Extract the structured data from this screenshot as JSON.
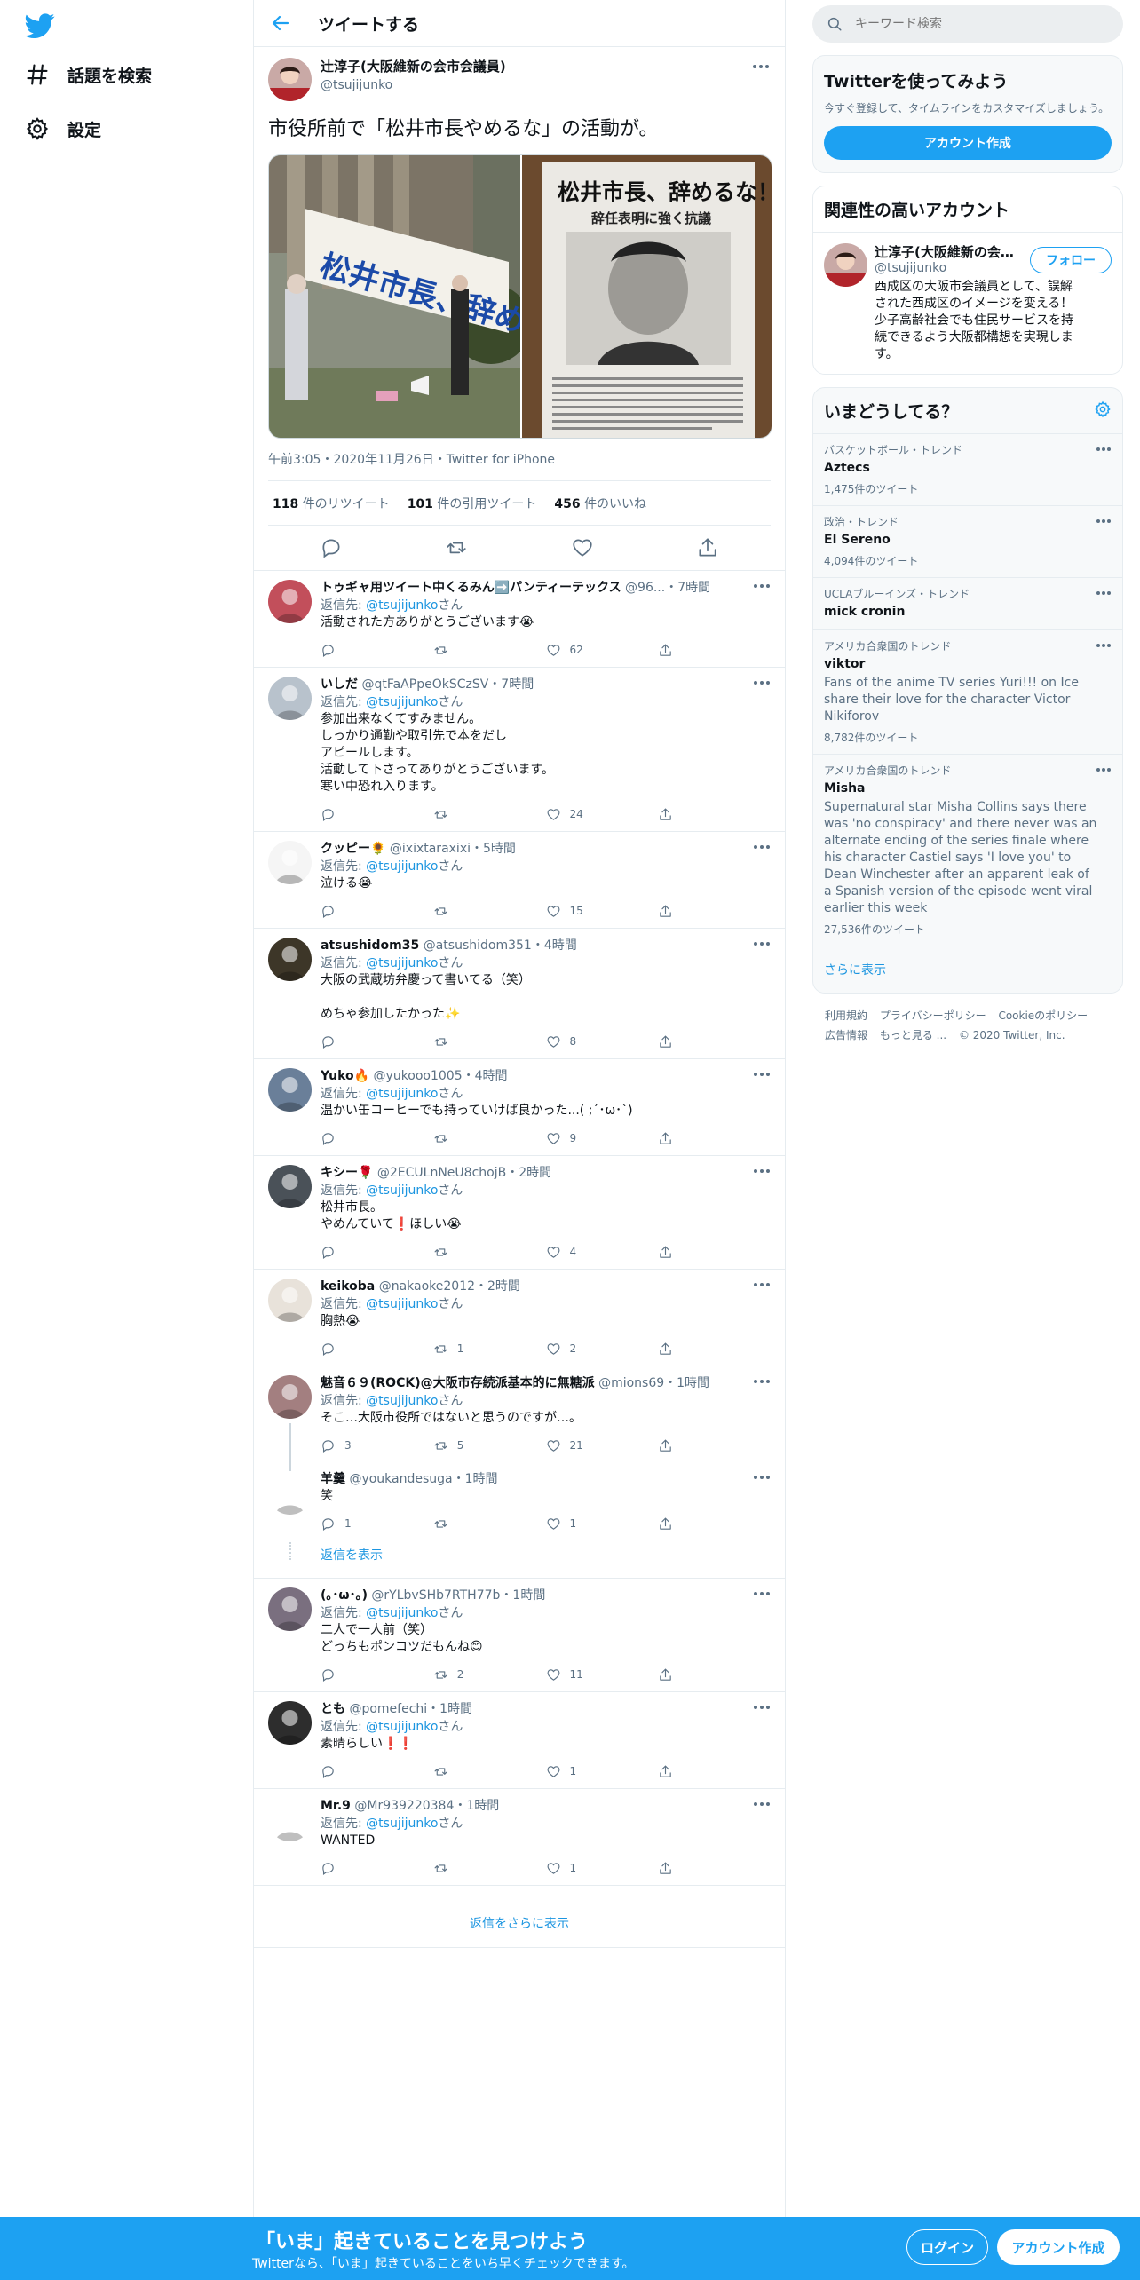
{
  "nav": {
    "explore_label": "話題を検索",
    "settings_label": "設定"
  },
  "header": {
    "title": "ツイートする"
  },
  "focal": {
    "name": "辻淳子(大阪維新の会市会議員)",
    "handle": "@tsujijunko",
    "text": "市役所前で「松井市長やめるな」の活動が。",
    "meta": "午前3:05・2020年11月26日・Twitter for iPhone",
    "stats": {
      "retweets_n": "118",
      "retweets_l": "件のリツイート",
      "quotes_n": "101",
      "quotes_l": "件の引用ツイート",
      "likes_n": "456",
      "likes_l": "件のいいね"
    },
    "banner_text": "松井市長、辞めるな！",
    "flyer_title": "松井市長、辞めるな！",
    "flyer_subtitle": "辞任表明に強く抗議"
  },
  "replies": [
    {
      "name": "トゥギャ用ツイート中くるみん➡️パンティーテックス",
      "handle": "@96...",
      "time": "・7時間",
      "to_label": "返信先: ",
      "to_user": "@tsujijunko",
      "to_suffix": "さん",
      "text": "活動された方ありがとうございます😭",
      "reply_count": "",
      "rt_count": "",
      "like_count": "62"
    },
    {
      "name": "いしだ",
      "handle": "@qtFaAPpeOkSCzSV",
      "time": "・7時間",
      "to_label": "返信先: ",
      "to_user": "@tsujijunko",
      "to_suffix": "さん",
      "text": "参加出来なくてすみません。\nしっかり通勤や取引先で本をだし\nアピールします。\n活動して下さってありがとうございます。\n寒い中恐れ入ります。",
      "reply_count": "",
      "rt_count": "",
      "like_count": "24"
    },
    {
      "name": "クッピー🌻",
      "handle": "@ixixtaraxixi",
      "time": "・5時間",
      "to_label": "返信先: ",
      "to_user": "@tsujijunko",
      "to_suffix": "さん",
      "text": "泣ける😭",
      "reply_count": "",
      "rt_count": "",
      "like_count": "15"
    },
    {
      "name": "atsushidom35",
      "handle": "@atsushidom351",
      "time": "・4時間",
      "to_label": "返信先: ",
      "to_user": "@tsujijunko",
      "to_suffix": "さん",
      "text": "大阪の武蔵坊弁慶って書いてる（笑）\n\nめちゃ参加したかった✨",
      "reply_count": "",
      "rt_count": "",
      "like_count": "8"
    },
    {
      "name": "Yuko🔥",
      "handle": "@yukooo1005",
      "time": "・4時間",
      "to_label": "返信先: ",
      "to_user": "@tsujijunko",
      "to_suffix": "さん",
      "text": "温かい缶コーヒーでも持っていけば良かった...( ;´･ω･`)",
      "reply_count": "",
      "rt_count": "",
      "like_count": "9"
    },
    {
      "name": "キシー🌹",
      "handle": "@2ECULnNeU8chojB",
      "time": "・2時間",
      "to_label": "返信先: ",
      "to_user": "@tsujijunko",
      "to_suffix": "さん",
      "text": "松井市長。\nやめんていて❗️ほしい😭",
      "reply_count": "",
      "rt_count": "",
      "like_count": "4"
    },
    {
      "name": "keikoba",
      "handle": "@nakaoke2012",
      "time": "・2時間",
      "to_label": "返信先: ",
      "to_user": "@tsujijunko",
      "to_suffix": "さん",
      "text": "胸熱😭",
      "reply_count": "",
      "rt_count": "1",
      "like_count": "2"
    },
    {
      "name": "魅音６９(ROCK)@大阪市存続派基本的に無糖派",
      "handle": "@mions69",
      "time": "・1時間",
      "to_label": "返信先: ",
      "to_user": "@tsujijunko",
      "to_suffix": "さん",
      "text": "そこ…大阪市役所ではないと思うのですが…。",
      "reply_count": "3",
      "rt_count": "5",
      "like_count": "21"
    },
    {
      "name": "羊羹",
      "handle": "@youkandesuga",
      "time": "・1時間",
      "to_label": "",
      "to_user": "",
      "to_suffix": "",
      "text": "笑",
      "reply_count": "1",
      "rt_count": "",
      "like_count": "1"
    },
    {
      "name": "(｡･ω･｡)",
      "handle": "@rYLbvSHb7RTH77b",
      "time": "・1時間",
      "to_label": "返信先: ",
      "to_user": "@tsujijunko",
      "to_suffix": "さん",
      "text": "二人で一人前（笑）\nどっちもポンコツだもんね😊",
      "reply_count": "",
      "rt_count": "2",
      "like_count": "11"
    },
    {
      "name": "とも",
      "handle": "@pomefechi",
      "time": "・1時間",
      "to_label": "返信先: ",
      "to_user": "@tsujijunko",
      "to_suffix": "さん",
      "text": "素晴らしい❗️❗️",
      "reply_count": "",
      "rt_count": "",
      "like_count": "1"
    },
    {
      "name": "Mr.9",
      "handle": "@Mr939220384",
      "time": "・1時間",
      "to_label": "返信先: ",
      "to_user": "@tsujijunko",
      "to_suffix": "さん",
      "text": "WANTED",
      "reply_count": "",
      "rt_count": "",
      "like_count": "1"
    }
  ],
  "show_replies_label": "返信を表示",
  "show_more_replies_label": "返信をさらに表示",
  "search": {
    "placeholder": "キーワード検索"
  },
  "join": {
    "title": "Twitterを使ってみよう",
    "desc": "今すぐ登録して、タイムラインをカスタマイズしましょう。",
    "button": "アカウント作成"
  },
  "related": {
    "title": "関連性の高いアカウント",
    "name": "辻淳子(大阪維新の会市会議員)",
    "handle": "@tsujijunko",
    "follow": "フォロー",
    "bio": "西成区の大阪市会議員として、誤解された西成区のイメージを変える！少子高齢社会でも住民サービスを持続できるよう大阪都構想を実現します。"
  },
  "trends": {
    "title": "いまどうしてる？",
    "items": [
      {
        "context": "バスケットボール・トレンド",
        "name": "Aztecs",
        "desc": "",
        "count": "1,475件のツイート"
      },
      {
        "context": "政治・トレンド",
        "name": "El Sereno",
        "desc": "",
        "count": "4,094件のツイート"
      },
      {
        "context": "UCLAブルーインズ・トレンド",
        "name": "mick cronin",
        "desc": "",
        "count": ""
      },
      {
        "context": "アメリカ合衆国のトレンド",
        "name": "viktor",
        "desc": "Fans of the anime TV series Yuri!!! on Ice share their love for the character Victor Nikiforov",
        "count": "8,782件のツイート"
      },
      {
        "context": "アメリカ合衆国のトレンド",
        "name": "Misha",
        "desc": "Supernatural star Misha Collins says there was 'no conspiracy' and there never was an alternate ending of the series finale where his character Castiel says 'I love you' to Dean Winchester after an apparent leak of a Spanish version of the episode went viral earlier this week",
        "count": "27,536件のツイート"
      }
    ],
    "show_more": "さらに表示"
  },
  "footer": {
    "terms": "利用規約",
    "privacy": "プライバシーポリシー",
    "cookie": "Cookieのポリシー",
    "ads": "広告情報",
    "more": "もっと見る ...",
    "copyright": "© 2020 Twitter, Inc."
  },
  "bottom": {
    "title": "「いま」起きていることを見つけよう",
    "subtitle": "Twitterなら、「いま」起きていることをいち早くチェックできます。",
    "login": "ログイン",
    "signup": "アカウント作成"
  },
  "colors": {
    "accent": "#1da1f2",
    "link": "#1b95e0",
    "muted": "#5b7083",
    "border": "#e6ecf0"
  }
}
